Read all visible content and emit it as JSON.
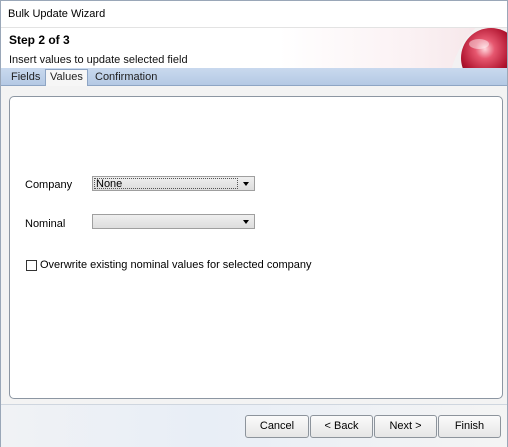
{
  "window": {
    "title": "Bulk Update Wizard"
  },
  "header": {
    "step": "Step 2 of 3",
    "subtitle": "Insert values to update selected field"
  },
  "tabs": [
    {
      "label": "Fields",
      "active": false
    },
    {
      "label": "Values",
      "active": true
    },
    {
      "label": "Confirmation",
      "active": false
    }
  ],
  "form": {
    "company_label": "Company",
    "company_value": "None",
    "nominal_label": "Nominal",
    "nominal_value": "",
    "overwrite_label": "Overwrite existing nominal values for selected company",
    "overwrite_checked": false
  },
  "buttons": {
    "cancel": "Cancel",
    "back": "< Back",
    "next": "Next >",
    "finish": "Finish"
  },
  "colors": {
    "tabstrip": "#b4c9e4",
    "orb": "#c41e3a"
  }
}
